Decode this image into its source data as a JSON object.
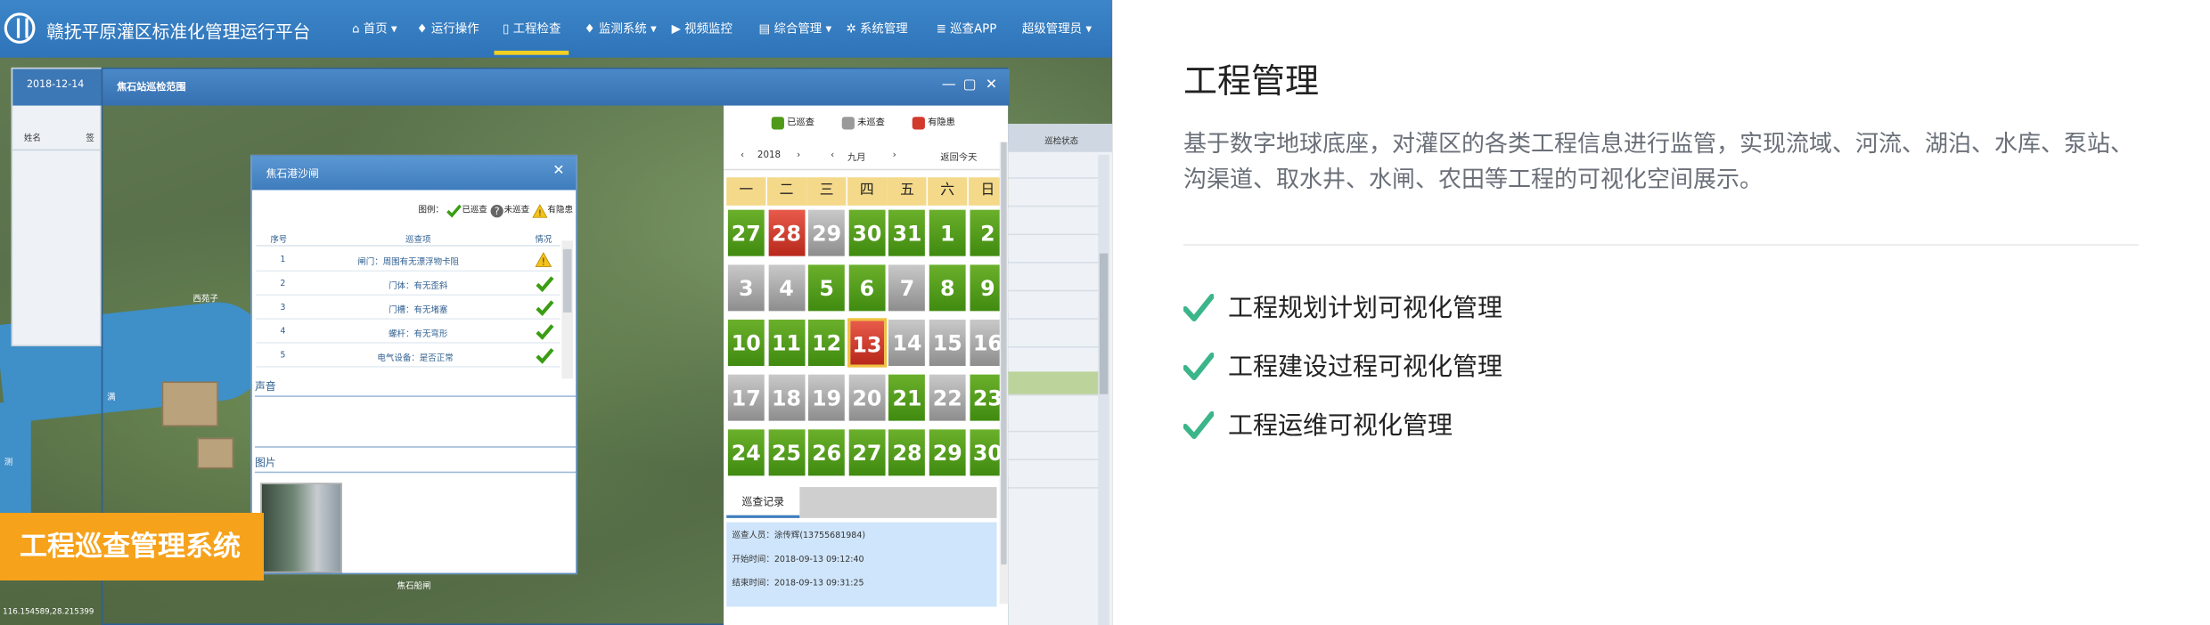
{
  "app": {
    "title": "赣抚平原灌区标准化管理运行平台",
    "nav": [
      "首页",
      "运行操作",
      "工程检查",
      "监测系统",
      "视频监控",
      "综合管理",
      "系统管理",
      "巡查APP",
      "超级管理员"
    ],
    "active_nav": "工程检查"
  },
  "left_panel": {
    "date": "2018-12-14",
    "col_name": "姓名",
    "col_short": "签"
  },
  "right_panel": {
    "header": "巡检状态"
  },
  "main_window": {
    "title": "焦石站巡检范围",
    "controls": [
      "—",
      "▢",
      "✕"
    ]
  },
  "map_labels": {
    "label_a": "西苑子",
    "label_b": "满",
    "label_c": "测",
    "label_d": "焦石船闸",
    "coords": "116.154589,28.215399"
  },
  "inspect_window": {
    "title": "焦石港沙闸",
    "legend_title": "图例：",
    "legend_items": [
      "已巡查",
      "未巡查",
      "有隐患"
    ],
    "columns": [
      "序号",
      "巡查项",
      "情况"
    ],
    "rows": [
      {
        "no": "1",
        "item": "闸门：周围有无漂浮物卡阻",
        "status": "warn"
      },
      {
        "no": "2",
        "item": "门体：有无歪斜",
        "status": "ok"
      },
      {
        "no": "3",
        "item": "门槽：有无堵塞",
        "status": "ok"
      },
      {
        "no": "4",
        "item": "螺杆：有无弯形",
        "status": "ok"
      },
      {
        "no": "5",
        "item": "电气设备：是否正常",
        "status": "ok"
      }
    ],
    "section_sound": "声音",
    "section_photo": "图片"
  },
  "calendar": {
    "legend": [
      "已巡查",
      "未巡查",
      "有隐患"
    ],
    "legend_colors": [
      "#4f9a18",
      "#9a9a9a",
      "#d23a2c"
    ],
    "year": "2018",
    "month": "九月",
    "today_link": "返回今天",
    "weekdays": [
      "一",
      "二",
      "三",
      "四",
      "五",
      "六",
      "日"
    ],
    "weeks": [
      [
        {
          "d": "27",
          "s": "g"
        },
        {
          "d": "28",
          "s": "r"
        },
        {
          "d": "29",
          "s": "n"
        },
        {
          "d": "30",
          "s": "g"
        },
        {
          "d": "31",
          "s": "g"
        },
        {
          "d": "1",
          "s": "g"
        },
        {
          "d": "2",
          "s": "g"
        }
      ],
      [
        {
          "d": "3",
          "s": "n"
        },
        {
          "d": "4",
          "s": "n"
        },
        {
          "d": "5",
          "s": "g"
        },
        {
          "d": "6",
          "s": "g"
        },
        {
          "d": "7",
          "s": "n"
        },
        {
          "d": "8",
          "s": "g"
        },
        {
          "d": "9",
          "s": "g"
        }
      ],
      [
        {
          "d": "10",
          "s": "g"
        },
        {
          "d": "11",
          "s": "g"
        },
        {
          "d": "12",
          "s": "g"
        },
        {
          "d": "13",
          "s": "r"
        },
        {
          "d": "14",
          "s": "n"
        },
        {
          "d": "15",
          "s": "n"
        },
        {
          "d": "16",
          "s": "n"
        }
      ],
      [
        {
          "d": "17",
          "s": "n"
        },
        {
          "d": "18",
          "s": "n"
        },
        {
          "d": "19",
          "s": "n"
        },
        {
          "d": "20",
          "s": "n"
        },
        {
          "d": "21",
          "s": "g"
        },
        {
          "d": "22",
          "s": "n"
        },
        {
          "d": "23",
          "s": "g"
        }
      ],
      [
        {
          "d": "24",
          "s": "g"
        },
        {
          "d": "25",
          "s": "g"
        },
        {
          "d": "26",
          "s": "g"
        },
        {
          "d": "27",
          "s": "g"
        },
        {
          "d": "28",
          "s": "g"
        },
        {
          "d": "29",
          "s": "g"
        },
        {
          "d": "30",
          "s": "g"
        }
      ]
    ],
    "today": "13",
    "record_tab": "巡查记录",
    "records": [
      "巡查人员：涂传辉(13755681984)",
      "开始时间：2018-09-13 09:12:40",
      "结束时间：2018-09-13 09:31:25"
    ]
  },
  "badge": "工程巡查管理系统",
  "info": {
    "title": "工程管理",
    "description": "基于数字地球底座，对灌区的各类工程信息进行监管，实现流域、河流、湖泊、水库、泵站、沟渠道、取水井、水闸、农田等工程的可视化空间展示。",
    "features": [
      "工程规划计划可视化管理",
      "工程建设过程可视化管理",
      "工程运维可视化管理"
    ],
    "accent_color": "#3bb58a"
  }
}
